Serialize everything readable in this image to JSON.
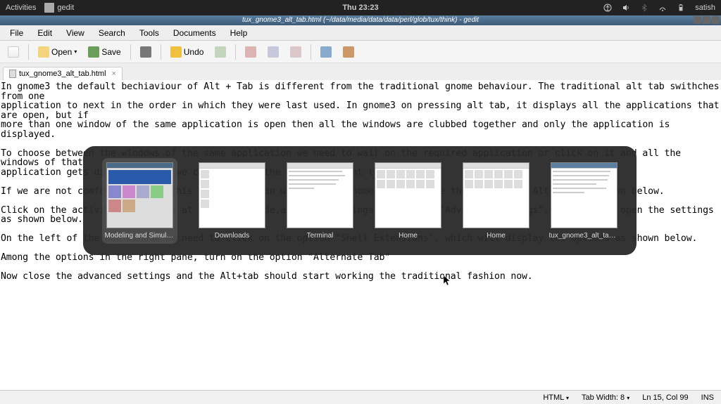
{
  "panel": {
    "activities": "Activities",
    "app_name": "gedit",
    "clock": "Thu 23:23",
    "user_name": "satish"
  },
  "titlebar": {
    "text": "tux_gnome3_alt_tab.html (~/data/media/data/data/perl/glob/tux/think) - gedit"
  },
  "menus": {
    "file": "File",
    "edit": "Edit",
    "view": "View",
    "search": "Search",
    "tools": "Tools",
    "documents": "Documents",
    "help": "Help"
  },
  "toolbar": {
    "open": "Open",
    "save": "Save",
    "undo": "Undo"
  },
  "tab": {
    "filename": "tux_gnome3_alt_tab.html"
  },
  "editor": {
    "content": "In gnome3 the default bechiaviour of Alt + Tab is different from the traditional gnome behaviour. The traditional alt tab swithches from one\napplication to next in the order in which they were last used. In gnome3 on pressing alt tab, it displays all the applications that are open, but if\nmore than one window of the same application is open then all the windows are clubbed together and only the application is displayed.\n\nTo choose between the windows of the same application we need to wait on the required application or click on it and all the windows of that\napplication gets displayed, and we can click on the window we want to open.\n\nIf we are not comfortable with this behaviour than we can make gnome perform like the traditions Alt+ Tab as shown below.\n\nClick on the activities and look at the right side,advanced settings by typing  \"Advanced Settings\", click on it open the settings as shown below.\n\nOn the left of the pop window we need to click on the option \"Shell Extensions\", which will display the options as shown below.\n\nAmong the options in the right pane, turn on the option \"Alternate Tab\"\n\nNow close the advanced settings and the Alt+tab should start working the traditional fashion now."
  },
  "statusbar": {
    "syntax": "HTML",
    "tab_width_label": "Tab Width:",
    "tab_width_value": "8",
    "position": "Ln 15, Col 99",
    "insert": "INS"
  },
  "switcher": {
    "items": [
      {
        "label": "Modeling and Simulatio..."
      },
      {
        "label": "Downloads"
      },
      {
        "label": "Terminal"
      },
      {
        "label": "Home"
      },
      {
        "label": "Home"
      },
      {
        "label": "tux_gnome3_alt_tab.ht..."
      }
    ]
  }
}
